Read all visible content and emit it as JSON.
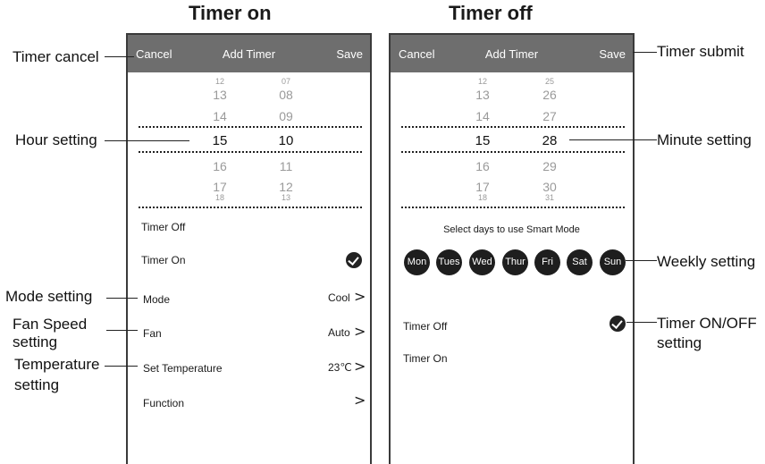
{
  "titles": {
    "left": "Timer on",
    "right": "Timer off"
  },
  "left_screen": {
    "cancel": "Cancel",
    "header": "Add Timer",
    "save": "Save",
    "hours": [
      "12",
      "13",
      "14",
      "15",
      "16",
      "17",
      "18"
    ],
    "minutes": [
      "07",
      "08",
      "09",
      "10",
      "11",
      "12",
      "13"
    ],
    "timer_off": "Timer Off",
    "timer_on": "Timer On",
    "mode_label": "Mode",
    "mode_value": "Cool",
    "fan_label": "Fan",
    "fan_value": "Auto",
    "temp_label": "Set Temperature",
    "temp_value": "23℃",
    "function_label": "Function",
    "chevron": ">"
  },
  "right_screen": {
    "cancel": "Cancel",
    "header": "Add Timer",
    "save": "Save",
    "hours": [
      "12",
      "13",
      "14",
      "15",
      "16",
      "17",
      "18"
    ],
    "minutes": [
      "25",
      "26",
      "27",
      "28",
      "29",
      "30",
      "31"
    ],
    "select_days": "Select days to use Smart Mode",
    "days": [
      "Mon",
      "Tues",
      "Wed",
      "Thur",
      "Fri",
      "Sat",
      "Sun"
    ],
    "timer_off": "Timer Off",
    "timer_on": "Timer On"
  },
  "annotations": {
    "timer_cancel": "Timer cancel",
    "hour_setting": "Hour setting",
    "mode_setting": "Mode setting",
    "fan_speed_1": "Fan Speed",
    "fan_speed_2": "setting",
    "temperature_1": "Temperature",
    "temperature_2": "setting",
    "timer_submit": "Timer submit",
    "minute_setting": "Minute setting",
    "weekly_setting": "Weekly setting",
    "timer_onoff_1": "Timer ON/OFF",
    "timer_onoff_2": "setting"
  }
}
